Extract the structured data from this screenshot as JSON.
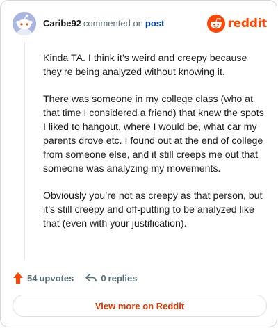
{
  "comment": {
    "username": "Caribe92",
    "action": "commented on",
    "target": "post",
    "paragraphs": [
      "Kinda TA. I think it’s weird and creepy because they’re being analyzed without knowing it.",
      "There was someone in my college class (who at that time I considered a friend) that knew the spots I liked to hangout, where I would be, what car my parents drove etc. I found out at the end of college from someone else, and it still creeps me out that someone was analyzing my movements.",
      "Obviously you’re not as creepy as that person, but it’s still creepy and off-putting to be analyzed like that (even with your justification)."
    ]
  },
  "brand": {
    "wordmark": "reddit",
    "logo_icon": "reddit-snoo-icon",
    "color": "#ff4500"
  },
  "footer": {
    "upvote_icon": "upvote-arrow-icon",
    "upvotes_count": "54",
    "upvotes_label": "upvotes",
    "reply_icon": "reply-arrow-icon",
    "replies_count": "0",
    "replies_label": "replies"
  },
  "view_more": {
    "label": "View more on Reddit",
    "color": "#d93900"
  },
  "avatar": {
    "icon": "snoo-avatar-icon",
    "background": "#a8b6e0"
  }
}
